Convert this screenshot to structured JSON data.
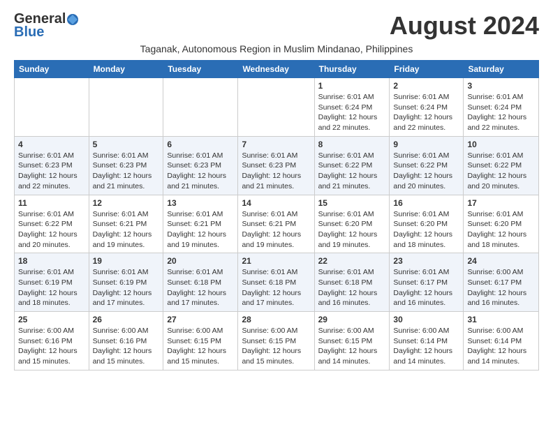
{
  "header": {
    "logo_general": "General",
    "logo_blue": "Blue",
    "month_title": "August 2024",
    "subtitle": "Taganak, Autonomous Region in Muslim Mindanao, Philippines"
  },
  "days_of_week": [
    "Sunday",
    "Monday",
    "Tuesday",
    "Wednesday",
    "Thursday",
    "Friday",
    "Saturday"
  ],
  "weeks": [
    [
      {
        "day": "",
        "info": ""
      },
      {
        "day": "",
        "info": ""
      },
      {
        "day": "",
        "info": ""
      },
      {
        "day": "",
        "info": ""
      },
      {
        "day": "1",
        "info": "Sunrise: 6:01 AM\nSunset: 6:24 PM\nDaylight: 12 hours\nand 22 minutes."
      },
      {
        "day": "2",
        "info": "Sunrise: 6:01 AM\nSunset: 6:24 PM\nDaylight: 12 hours\nand 22 minutes."
      },
      {
        "day": "3",
        "info": "Sunrise: 6:01 AM\nSunset: 6:24 PM\nDaylight: 12 hours\nand 22 minutes."
      }
    ],
    [
      {
        "day": "4",
        "info": "Sunrise: 6:01 AM\nSunset: 6:23 PM\nDaylight: 12 hours\nand 22 minutes."
      },
      {
        "day": "5",
        "info": "Sunrise: 6:01 AM\nSunset: 6:23 PM\nDaylight: 12 hours\nand 21 minutes."
      },
      {
        "day": "6",
        "info": "Sunrise: 6:01 AM\nSunset: 6:23 PM\nDaylight: 12 hours\nand 21 minutes."
      },
      {
        "day": "7",
        "info": "Sunrise: 6:01 AM\nSunset: 6:23 PM\nDaylight: 12 hours\nand 21 minutes."
      },
      {
        "day": "8",
        "info": "Sunrise: 6:01 AM\nSunset: 6:22 PM\nDaylight: 12 hours\nand 21 minutes."
      },
      {
        "day": "9",
        "info": "Sunrise: 6:01 AM\nSunset: 6:22 PM\nDaylight: 12 hours\nand 20 minutes."
      },
      {
        "day": "10",
        "info": "Sunrise: 6:01 AM\nSunset: 6:22 PM\nDaylight: 12 hours\nand 20 minutes."
      }
    ],
    [
      {
        "day": "11",
        "info": "Sunrise: 6:01 AM\nSunset: 6:22 PM\nDaylight: 12 hours\nand 20 minutes."
      },
      {
        "day": "12",
        "info": "Sunrise: 6:01 AM\nSunset: 6:21 PM\nDaylight: 12 hours\nand 19 minutes."
      },
      {
        "day": "13",
        "info": "Sunrise: 6:01 AM\nSunset: 6:21 PM\nDaylight: 12 hours\nand 19 minutes."
      },
      {
        "day": "14",
        "info": "Sunrise: 6:01 AM\nSunset: 6:21 PM\nDaylight: 12 hours\nand 19 minutes."
      },
      {
        "day": "15",
        "info": "Sunrise: 6:01 AM\nSunset: 6:20 PM\nDaylight: 12 hours\nand 19 minutes."
      },
      {
        "day": "16",
        "info": "Sunrise: 6:01 AM\nSunset: 6:20 PM\nDaylight: 12 hours\nand 18 minutes."
      },
      {
        "day": "17",
        "info": "Sunrise: 6:01 AM\nSunset: 6:20 PM\nDaylight: 12 hours\nand 18 minutes."
      }
    ],
    [
      {
        "day": "18",
        "info": "Sunrise: 6:01 AM\nSunset: 6:19 PM\nDaylight: 12 hours\nand 18 minutes."
      },
      {
        "day": "19",
        "info": "Sunrise: 6:01 AM\nSunset: 6:19 PM\nDaylight: 12 hours\nand 17 minutes."
      },
      {
        "day": "20",
        "info": "Sunrise: 6:01 AM\nSunset: 6:18 PM\nDaylight: 12 hours\nand 17 minutes."
      },
      {
        "day": "21",
        "info": "Sunrise: 6:01 AM\nSunset: 6:18 PM\nDaylight: 12 hours\nand 17 minutes."
      },
      {
        "day": "22",
        "info": "Sunrise: 6:01 AM\nSunset: 6:18 PM\nDaylight: 12 hours\nand 16 minutes."
      },
      {
        "day": "23",
        "info": "Sunrise: 6:01 AM\nSunset: 6:17 PM\nDaylight: 12 hours\nand 16 minutes."
      },
      {
        "day": "24",
        "info": "Sunrise: 6:00 AM\nSunset: 6:17 PM\nDaylight: 12 hours\nand 16 minutes."
      }
    ],
    [
      {
        "day": "25",
        "info": "Sunrise: 6:00 AM\nSunset: 6:16 PM\nDaylight: 12 hours\nand 15 minutes."
      },
      {
        "day": "26",
        "info": "Sunrise: 6:00 AM\nSunset: 6:16 PM\nDaylight: 12 hours\nand 15 minutes."
      },
      {
        "day": "27",
        "info": "Sunrise: 6:00 AM\nSunset: 6:15 PM\nDaylight: 12 hours\nand 15 minutes."
      },
      {
        "day": "28",
        "info": "Sunrise: 6:00 AM\nSunset: 6:15 PM\nDaylight: 12 hours\nand 15 minutes."
      },
      {
        "day": "29",
        "info": "Sunrise: 6:00 AM\nSunset: 6:15 PM\nDaylight: 12 hours\nand 14 minutes."
      },
      {
        "day": "30",
        "info": "Sunrise: 6:00 AM\nSunset: 6:14 PM\nDaylight: 12 hours\nand 14 minutes."
      },
      {
        "day": "31",
        "info": "Sunrise: 6:00 AM\nSunset: 6:14 PM\nDaylight: 12 hours\nand 14 minutes."
      }
    ]
  ]
}
